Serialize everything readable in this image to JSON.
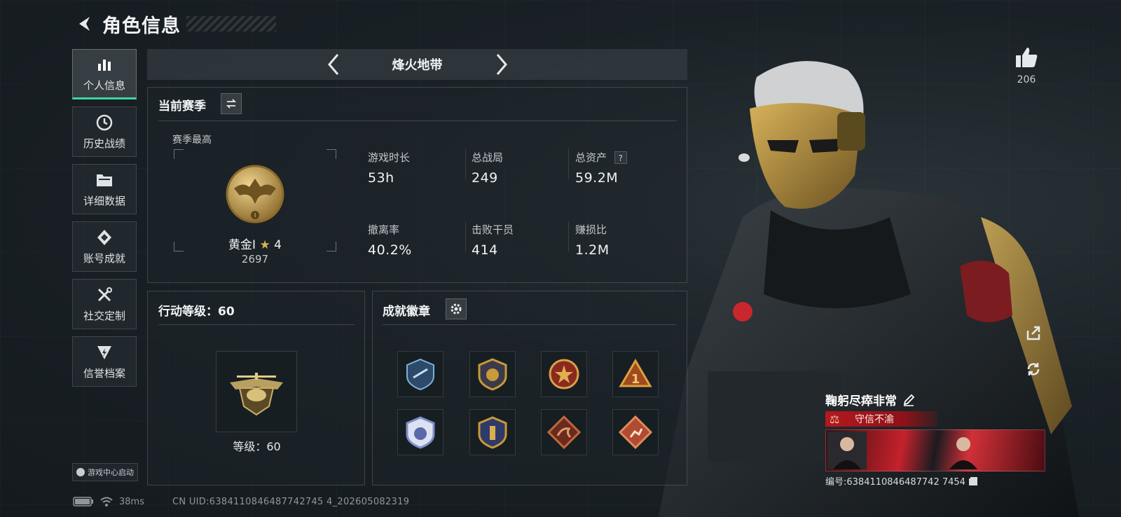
{
  "header": {
    "title": "角色信息"
  },
  "sidebar": {
    "items": [
      {
        "label": "个人信息",
        "icon": "bar-chart-icon",
        "active": true
      },
      {
        "label": "历史战绩",
        "icon": "clock-icon",
        "active": false
      },
      {
        "label": "详细数据",
        "icon": "folder-icon",
        "active": false
      },
      {
        "label": "账号成就",
        "icon": "diamond-badge-icon",
        "active": false
      },
      {
        "label": "社交定制",
        "icon": "tools-icon",
        "active": false
      },
      {
        "label": "信誉档案",
        "icon": "shield-lightning-icon",
        "active": false
      }
    ],
    "launch_label": "游戏中心启动"
  },
  "mode": {
    "name": "烽火地带"
  },
  "season": {
    "title": "当前赛季",
    "best_label": "赛季最高",
    "rank_name": "黄金I",
    "rank_stars": "4",
    "rank_score": "2697",
    "stats": [
      {
        "label": "游戏时长",
        "value": "53h"
      },
      {
        "label": "总战局",
        "value": "249"
      },
      {
        "label": "总资产",
        "value": "59.2M",
        "help": "?"
      },
      {
        "label": "撤离率",
        "value": "40.2%"
      },
      {
        "label": "击败干员",
        "value": "414"
      },
      {
        "label": "赚损比",
        "value": "1.2M"
      }
    ]
  },
  "action_level": {
    "title": "行动等级：60",
    "level_text": "等级：60"
  },
  "badges": {
    "title": "成就徽章",
    "items": [
      {
        "icon": "tech-crest-badge-icon",
        "color": "#4c7fb0"
      },
      {
        "icon": "gold-wing-badge-icon",
        "color": "#c79a3a"
      },
      {
        "icon": "red-star-badge-icon",
        "color": "#b8412c"
      },
      {
        "icon": "number-one-triangle-badge-icon",
        "color": "#c8842a"
      },
      {
        "icon": "blue-shield-badge-icon",
        "color": "#7d8fc6"
      },
      {
        "icon": "gold-shield-badge-icon",
        "color": "#c99a35"
      },
      {
        "icon": "dragon-diamond-badge-icon",
        "color": "#b5533a"
      },
      {
        "icon": "runner-diamond-badge-icon",
        "color": "#c0563c"
      }
    ]
  },
  "status": {
    "ping": "38ms",
    "uid": "CN UID:6384110846487742745 4_202605082319"
  },
  "profile": {
    "likes": "206",
    "name": "鞠躬尽瘁非常",
    "motto": "守信不渝",
    "serial": "编号:6384110846487742 7454"
  },
  "colors": {
    "accent": "#3fd6a0",
    "motto_red": "#b51820",
    "gold": "#c79a3a"
  }
}
